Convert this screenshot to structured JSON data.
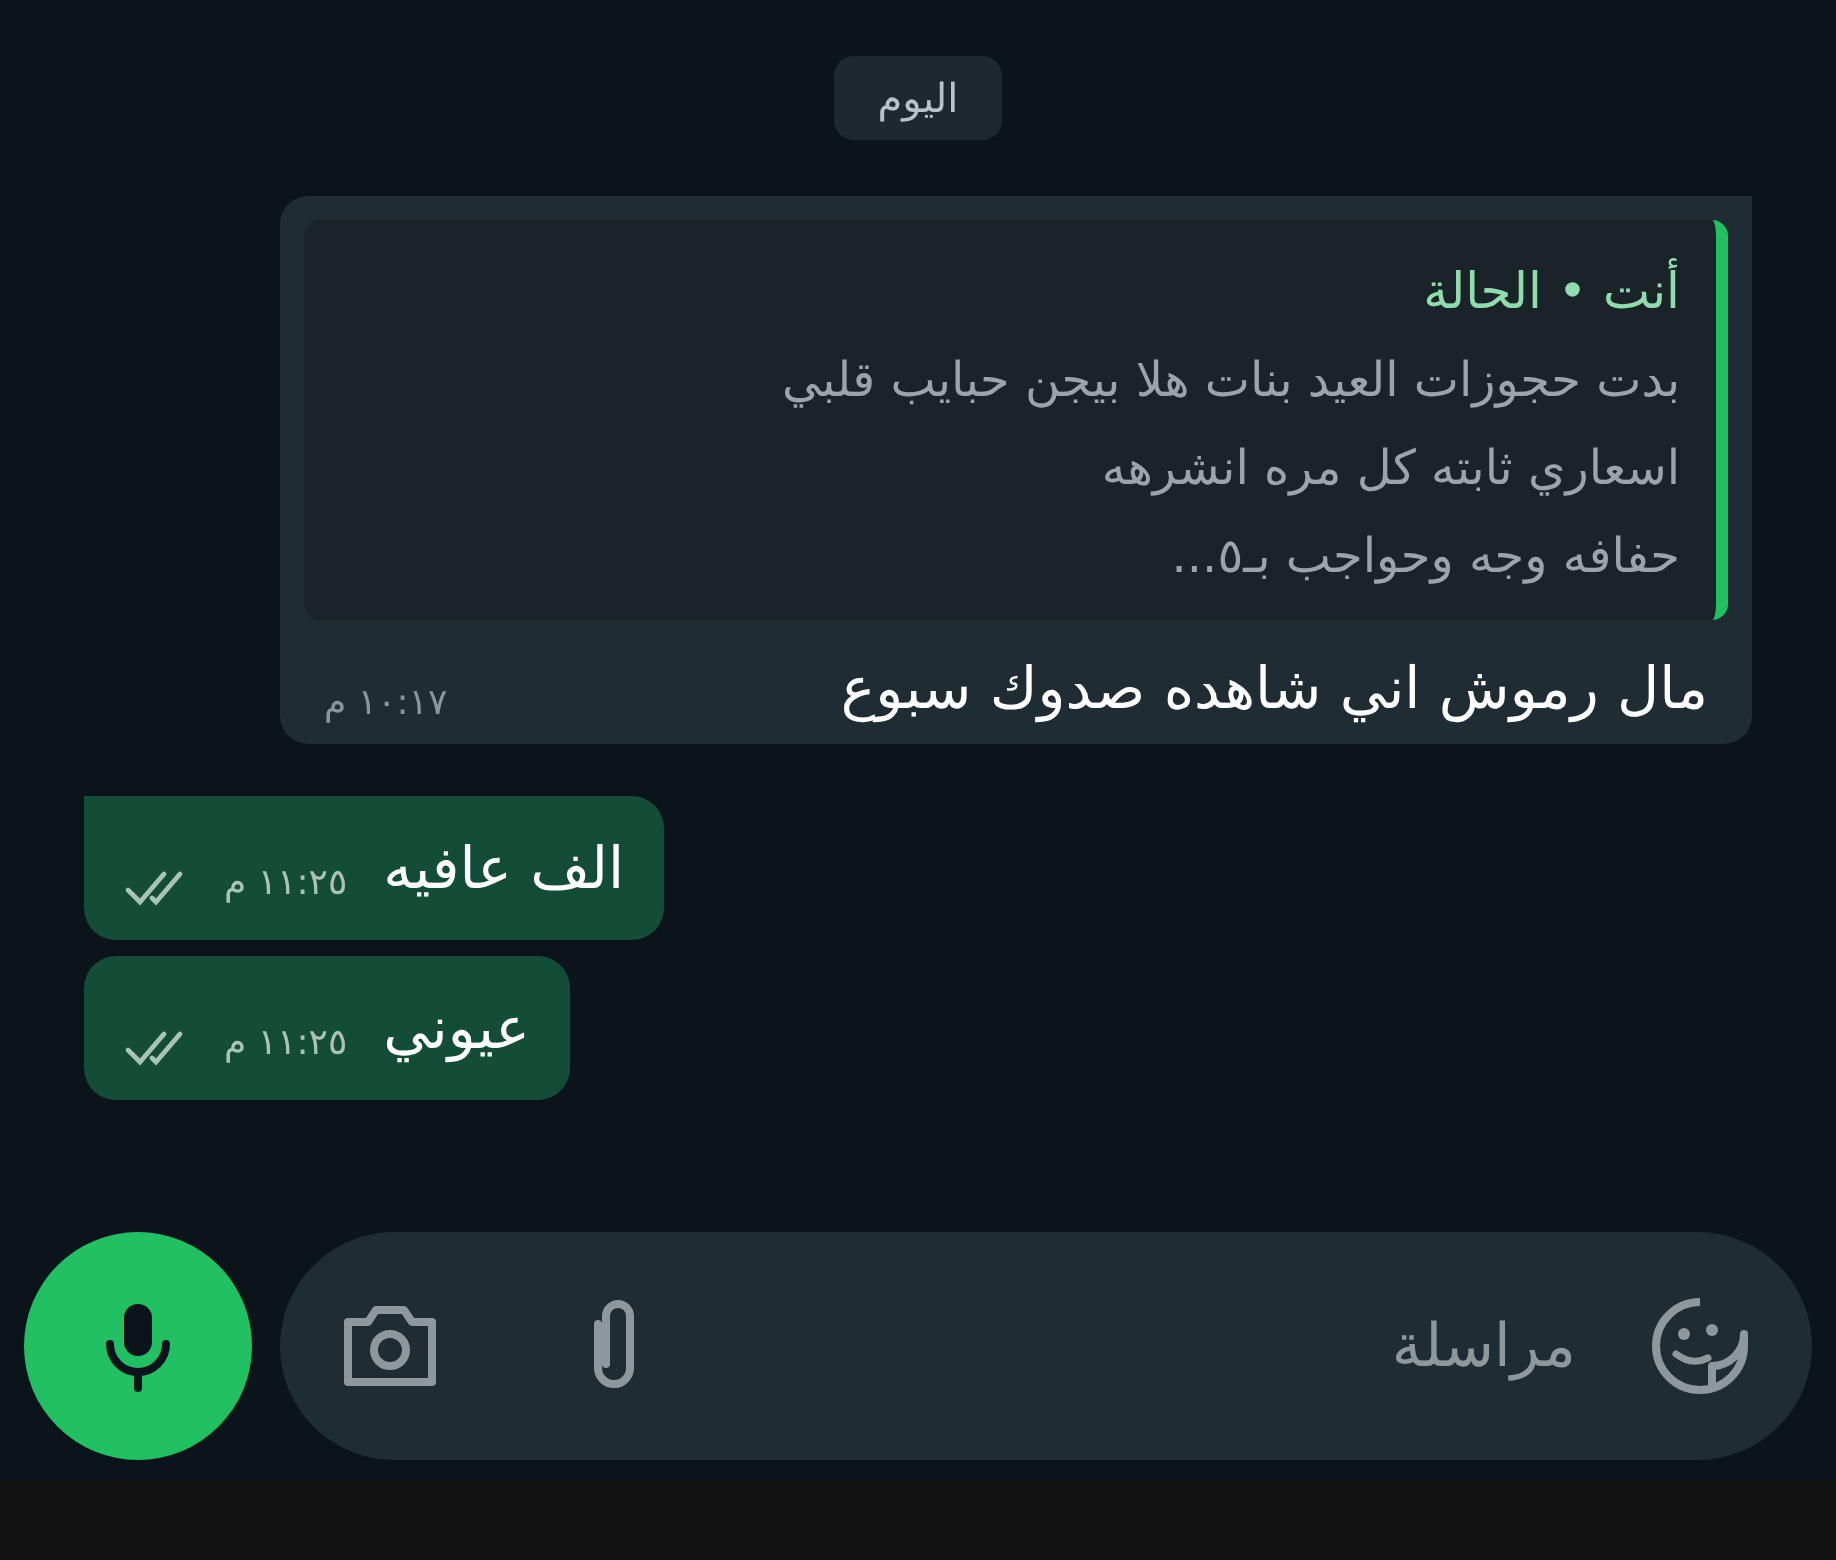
{
  "date_chip": "اليوم",
  "messages": [
    {
      "kind": "incoming",
      "quote": {
        "author": "أنت • الحالة",
        "lines": [
          "بدت حجوزات العيد بنات هلا بيجن حبايب قلبي",
          "اسعاري ثابته كل مره انشرهه",
          "حفافه وجه وحواجب بـ٥..."
        ]
      },
      "text": "مال رموش  اني شاهده صدوك سبوع",
      "time": "١٠:١٧ م"
    },
    {
      "kind": "outgoing",
      "text": "الف عافيه",
      "time": "١١:٢٥ م",
      "read": false
    },
    {
      "kind": "outgoing",
      "text": "عيوني",
      "time": "١١:٢٥ م",
      "read": false
    }
  ],
  "composer": {
    "placeholder": "مراسلة"
  }
}
